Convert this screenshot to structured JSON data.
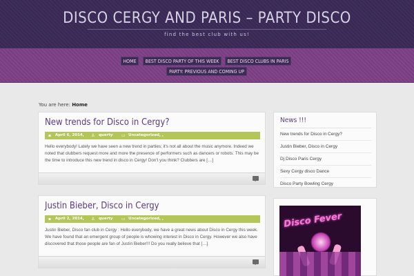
{
  "header": {
    "title": "DISCO CERGY AND PARIS – PARTY DISCO",
    "tagline": "find the best club with us!"
  },
  "nav": {
    "items": [
      {
        "label": "HOME"
      },
      {
        "label": "BEST DISCO PARTY OF THIS WEEK"
      },
      {
        "label": "BEST DISCO CLUBS IN PARIS"
      },
      {
        "label": "PARTY: PREVIOUS AND COMING UP"
      }
    ]
  },
  "breadcrumb": {
    "prefix": "You are here:",
    "current": "Home"
  },
  "posts": [
    {
      "title": "New trends for Disco in Cergy?",
      "date": "April 6, 2014,",
      "author": "querty",
      "category": "Uncategorized, ,",
      "excerpt": "Hello everybody! Lately we have seen a new trend in parties; it's not all about the music anymore. Indeed we noted that clubbers request more and more the presence of performers such as dancers or robots. This may be the time to introduce this new trend in disco in Cergy! Don't you think? Clubbers are […]"
    },
    {
      "title": "Justin Bieber, Disco in Cergy",
      "date": "April 2, 2014,",
      "author": "querty",
      "category": "Uncategorized, ,",
      "excerpt": "Justin Bieber, Disco fan club in Cergy : Hello everybody, we have a great news about Disco in Cergy this week. We have found that an emergent group of people is whowing interest in Disco in Cergy. However we also have discovered that those people are fan of Justin Bieber!!! Do you really believe that […]"
    }
  ],
  "sidebar": {
    "news_title": "News !!!",
    "news_items": [
      "New trends for Disco in Cergy?",
      "Justin Bieber, Disco in Cergy",
      "Dj Disco Paris Cergy",
      "Sexy Cergy disco Dance",
      "Disco Party Bowling Cergy"
    ],
    "poster_text": "Disco Fever"
  },
  "colors": {
    "header_bg": "#3a2a56",
    "nav_bg": "#7e3f86",
    "meta_bar": "#b4c55a",
    "title_purple": "#5a3a83"
  }
}
